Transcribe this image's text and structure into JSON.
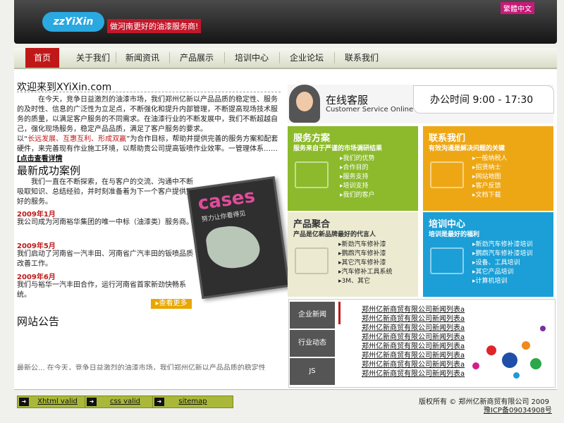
{
  "header": {
    "logo_text": "zzYiXin",
    "slogan": "做河南更好的油漆服务商!",
    "lang_switch": "繁體中文"
  },
  "nav": {
    "items": [
      {
        "label": "首页",
        "active": true
      },
      {
        "label": "关于我们"
      },
      {
        "label": "新闻资讯"
      },
      {
        "label": "产品展示"
      },
      {
        "label": "培训中心"
      },
      {
        "label": "企业论坛"
      },
      {
        "label": "联系我们"
      }
    ]
  },
  "welcome": {
    "title": "欢迎来到XYiXin.com",
    "p1": "在今天，竞争日益激烈的油漆市场，我们郑州亿新以产品品质的稳定性、服务的及时性、信息的广泛性为立足点，不断强化和提升内部管理，不断提高现场技术服务的质量，以满足客户服务的不同需求。在油漆行业的不断发展中，我们不断超越自己，强化现场服务，稳定产品品质，满足了客户服务的要求。",
    "p2_prefix": "以“",
    "p2_highlight": "长远发展、互惠互利、形成双赢",
    "p2_suffix": "”为合作目标，帮助并提供完善的服务方案和配套硬件，来完善现有作业施工环境，以帮助贵公司提高钣喷作业效率。一管理体系…… ",
    "more_link": "[点击查看详情"
  },
  "cases": {
    "title": "最新成功案例",
    "intro": "我们一直在不断探索，在与客户的交流、沟通中不断吸取知识、总结经验，并时刻准备着为下一个客户提供更好的服务。",
    "items": [
      {
        "date": "2009年1月",
        "desc": "我公司成为河南裕华集团的唯一中标（油漆类）服务商。"
      },
      {
        "date": "2009年5月",
        "desc": "我们启动了河南省一汽丰田、河南省广汽丰田的钣喷品质改善工作。"
      },
      {
        "date": "2009年6月",
        "desc": "我们与裕华一汽丰田合作，运行河南省首家新劲快畅系统。"
      }
    ],
    "view_more": "查看更多",
    "image_title": "cases",
    "image_sub": "努力让你看得见"
  },
  "notice": {
    "title": "网站公告",
    "text": "最新公...  在今天，竞争日益激烈的油漆市场，我们郑州亿新以产品品质的稳定性"
  },
  "service": {
    "title": "在线客服",
    "subtitle": "Customer Service Online",
    "hours": "办公时间 9:00 - 17:30"
  },
  "tiles": [
    {
      "title": "服务方案",
      "sub": "服务来自于严谨的市场调研结果",
      "color": "#8cba2c",
      "items": [
        "我们的优势",
        "合作目的",
        "服务支持",
        "培训支持",
        "我们的客户"
      ]
    },
    {
      "title": "联系我们",
      "sub": "有效沟通是解决问题的关键",
      "color": "#eea714",
      "items": [
        "一般纳税人",
        "招贤纳士",
        "网站地图",
        "客户反馈",
        "文档下载"
      ]
    },
    {
      "title": "产品聚合",
      "sub": "产品是亿新品牌最好的代言人",
      "color": "#ecebd2",
      "items": [
        "新劲汽车修补漆",
        "鹦鹉汽车修补漆",
        "其它汽车修补漆",
        "汽车修补工具系统",
        "3M、其它"
      ]
    },
    {
      "title": "培训中心",
      "sub": "培训是最好的福利",
      "color": "#1b9fd6",
      "items": [
        "新劲汽车修补漆培训",
        "鹦鹉汽车修补漆培训",
        "设备、工具培训",
        "其它产品培训",
        "计算机培训"
      ]
    }
  ],
  "news": {
    "tabs": [
      "企业新闻",
      "行业动态",
      "JS"
    ],
    "items": [
      "郑州亿新商贸有限公司新闻列表a",
      "郑州亿新商贸有限公司新闻列表a",
      "郑州亿新商贸有限公司新闻列表a",
      "郑州亿新商贸有限公司新闻列表a",
      "郑州亿新商贸有限公司新闻列表a",
      "郑州亿新商贸有限公司新闻列表a",
      "郑州亿新商贸有限公司新闻列表a",
      "郑州亿新商贸有限公司新闻列表a"
    ]
  },
  "footer": {
    "badges": [
      "Xhtml valid",
      "css valid",
      "sitemap"
    ],
    "copyright": "版权所有 © 郑州亿新商贸有限公司 2009",
    "icp": "豫ICP备09034908号"
  },
  "colors": {
    "accent_red": "#c01818",
    "nav_bg": "#e3e7d3",
    "green": "#8cba2c",
    "orange": "#eea714",
    "blue": "#1b9fd6"
  }
}
